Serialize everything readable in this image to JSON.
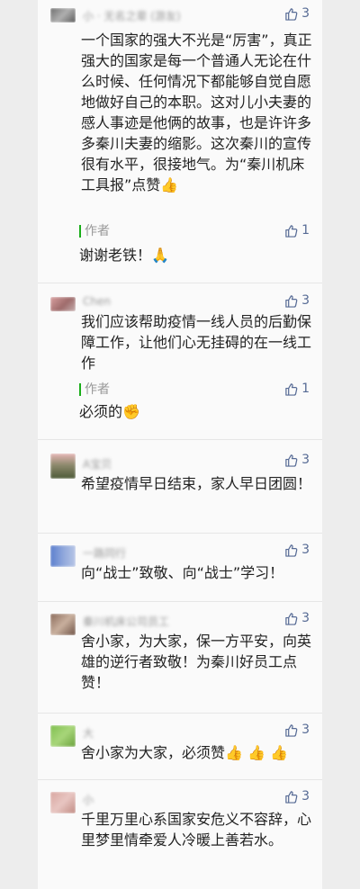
{
  "comments": [
    {
      "user": "小 ·  无名之辈 (游友)",
      "likes": "3",
      "text": "一个国家的强大不光是“厉害”，真正强大的国家是每一个普通人无论在什么时候、任何情况下都能够自觉自愿地做好自己的本职。这对儿小夫妻的感人事迹是他俩的故事，也是许许多多秦川夫妻的缩影。这次秦川的宣传很有水平，很接地气。为“秦川机床工具报”点赞👍",
      "reply": {
        "label": "作者",
        "likes": "1",
        "text": "谢谢老铁！🙏"
      }
    },
    {
      "user": "Chen",
      "likes": "3",
      "text": "我们应该帮助疫情一线人员的后勤保障工作，让他们心无挂碍的在一线工作",
      "reply": {
        "label": "作者",
        "likes": "1",
        "text": "必须的✊"
      }
    },
    {
      "user": "A宝贝",
      "likes": "3",
      "text": "希望疫情早日结束，家人早日团圆！"
    },
    {
      "user": "一路同行",
      "likes": "3",
      "text": "向“战士”致敬、向“战士”学习！"
    },
    {
      "user": "秦川机床公司员工",
      "likes": "3",
      "text": "舍小家，为大家，保一方平安，向英雄的逆行者致敬！为秦川好员工点赞！"
    },
    {
      "user": "大",
      "likes": "3",
      "text": "舍小家为大家，必须赞👍 👍 👍"
    },
    {
      "user": "小",
      "likes": "3",
      "text": "千里万里心系国家安危义不容辞，心里梦里情牵爱人冷暖上善若水。"
    }
  ],
  "colors": {
    "link": "#576b95",
    "author_bar": "#1aad19"
  },
  "icons": {
    "like": "thumbs-up-outline-icon"
  }
}
